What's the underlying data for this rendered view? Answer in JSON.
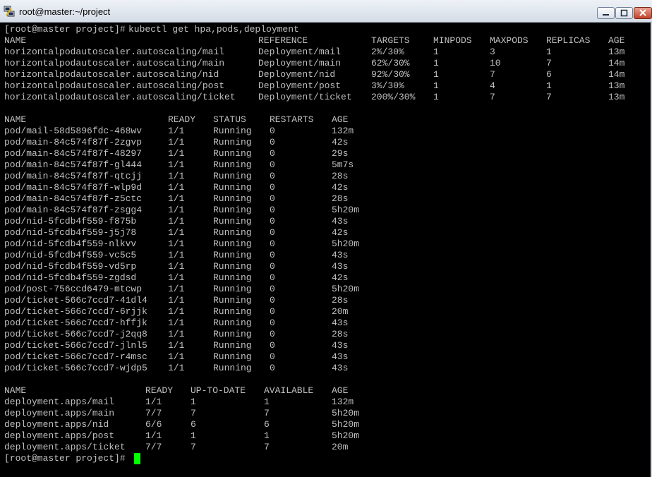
{
  "window": {
    "title": "root@master:~/project"
  },
  "prompt": "[root@master project]# ",
  "command": "kubectl get hpa,pods,deployment",
  "hpa": {
    "headers": [
      "NAME",
      "REFERENCE",
      "TARGETS",
      "MINPODS",
      "MAXPODS",
      "REPLICAS",
      "AGE"
    ],
    "rows": [
      [
        "horizontalpodautoscaler.autoscaling/mail",
        "Deployment/mail",
        "2%/30%",
        "1",
        "3",
        "1",
        "13m"
      ],
      [
        "horizontalpodautoscaler.autoscaling/main",
        "Deployment/main",
        "62%/30%",
        "1",
        "10",
        "7",
        "14m"
      ],
      [
        "horizontalpodautoscaler.autoscaling/nid",
        "Deployment/nid",
        "92%/30%",
        "1",
        "7",
        "6",
        "14m"
      ],
      [
        "horizontalpodautoscaler.autoscaling/post",
        "Deployment/post",
        "3%/30%",
        "1",
        "4",
        "1",
        "13m"
      ],
      [
        "horizontalpodautoscaler.autoscaling/ticket",
        "Deployment/ticket",
        "200%/30%",
        "1",
        "7",
        "7",
        "13m"
      ]
    ]
  },
  "pods": {
    "headers": [
      "NAME",
      "READY",
      "STATUS",
      "RESTARTS",
      "AGE"
    ],
    "rows": [
      [
        "pod/mail-58d5896fdc-468wv",
        "1/1",
        "Running",
        "0",
        "132m"
      ],
      [
        "pod/main-84c574f87f-2zgvp",
        "1/1",
        "Running",
        "0",
        "42s"
      ],
      [
        "pod/main-84c574f87f-48297",
        "1/1",
        "Running",
        "0",
        "29s"
      ],
      [
        "pod/main-84c574f87f-gl444",
        "1/1",
        "Running",
        "0",
        "5m7s"
      ],
      [
        "pod/main-84c574f87f-qtcjj",
        "1/1",
        "Running",
        "0",
        "28s"
      ],
      [
        "pod/main-84c574f87f-wlp9d",
        "1/1",
        "Running",
        "0",
        "42s"
      ],
      [
        "pod/main-84c574f87f-z5ctc",
        "1/1",
        "Running",
        "0",
        "28s"
      ],
      [
        "pod/main-84c574f87f-zsgg4",
        "1/1",
        "Running",
        "0",
        "5h20m"
      ],
      [
        "pod/nid-5fcdb4f559-f875b",
        "1/1",
        "Running",
        "0",
        "43s"
      ],
      [
        "pod/nid-5fcdb4f559-j5j78",
        "1/1",
        "Running",
        "0",
        "42s"
      ],
      [
        "pod/nid-5fcdb4f559-nlkvv",
        "1/1",
        "Running",
        "0",
        "5h20m"
      ],
      [
        "pod/nid-5fcdb4f559-vc5c5",
        "1/1",
        "Running",
        "0",
        "43s"
      ],
      [
        "pod/nid-5fcdb4f559-vd5rp",
        "1/1",
        "Running",
        "0",
        "43s"
      ],
      [
        "pod/nid-5fcdb4f559-zgdsd",
        "1/1",
        "Running",
        "0",
        "42s"
      ],
      [
        "pod/post-756ccd6479-mtcwp",
        "1/1",
        "Running",
        "0",
        "5h20m"
      ],
      [
        "pod/ticket-566c7ccd7-41dl4",
        "1/1",
        "Running",
        "0",
        "28s"
      ],
      [
        "pod/ticket-566c7ccd7-6rjjk",
        "1/1",
        "Running",
        "0",
        "20m"
      ],
      [
        "pod/ticket-566c7ccd7-hffjk",
        "1/1",
        "Running",
        "0",
        "43s"
      ],
      [
        "pod/ticket-566c7ccd7-j2qq8",
        "1/1",
        "Running",
        "0",
        "28s"
      ],
      [
        "pod/ticket-566c7ccd7-jlnl5",
        "1/1",
        "Running",
        "0",
        "43s"
      ],
      [
        "pod/ticket-566c7ccd7-r4msc",
        "1/1",
        "Running",
        "0",
        "43s"
      ],
      [
        "pod/ticket-566c7ccd7-wjdp5",
        "1/1",
        "Running",
        "0",
        "43s"
      ]
    ]
  },
  "deployments": {
    "headers": [
      "NAME",
      "READY",
      "UP-TO-DATE",
      "AVAILABLE",
      "AGE"
    ],
    "rows": [
      [
        "deployment.apps/mail",
        "1/1",
        "1",
        "1",
        "132m"
      ],
      [
        "deployment.apps/main",
        "7/7",
        "7",
        "7",
        "5h20m"
      ],
      [
        "deployment.apps/nid",
        "6/6",
        "6",
        "6",
        "5h20m"
      ],
      [
        "deployment.apps/post",
        "1/1",
        "1",
        "1",
        "5h20m"
      ],
      [
        "deployment.apps/ticket",
        "7/7",
        "7",
        "7",
        "20m"
      ]
    ]
  }
}
